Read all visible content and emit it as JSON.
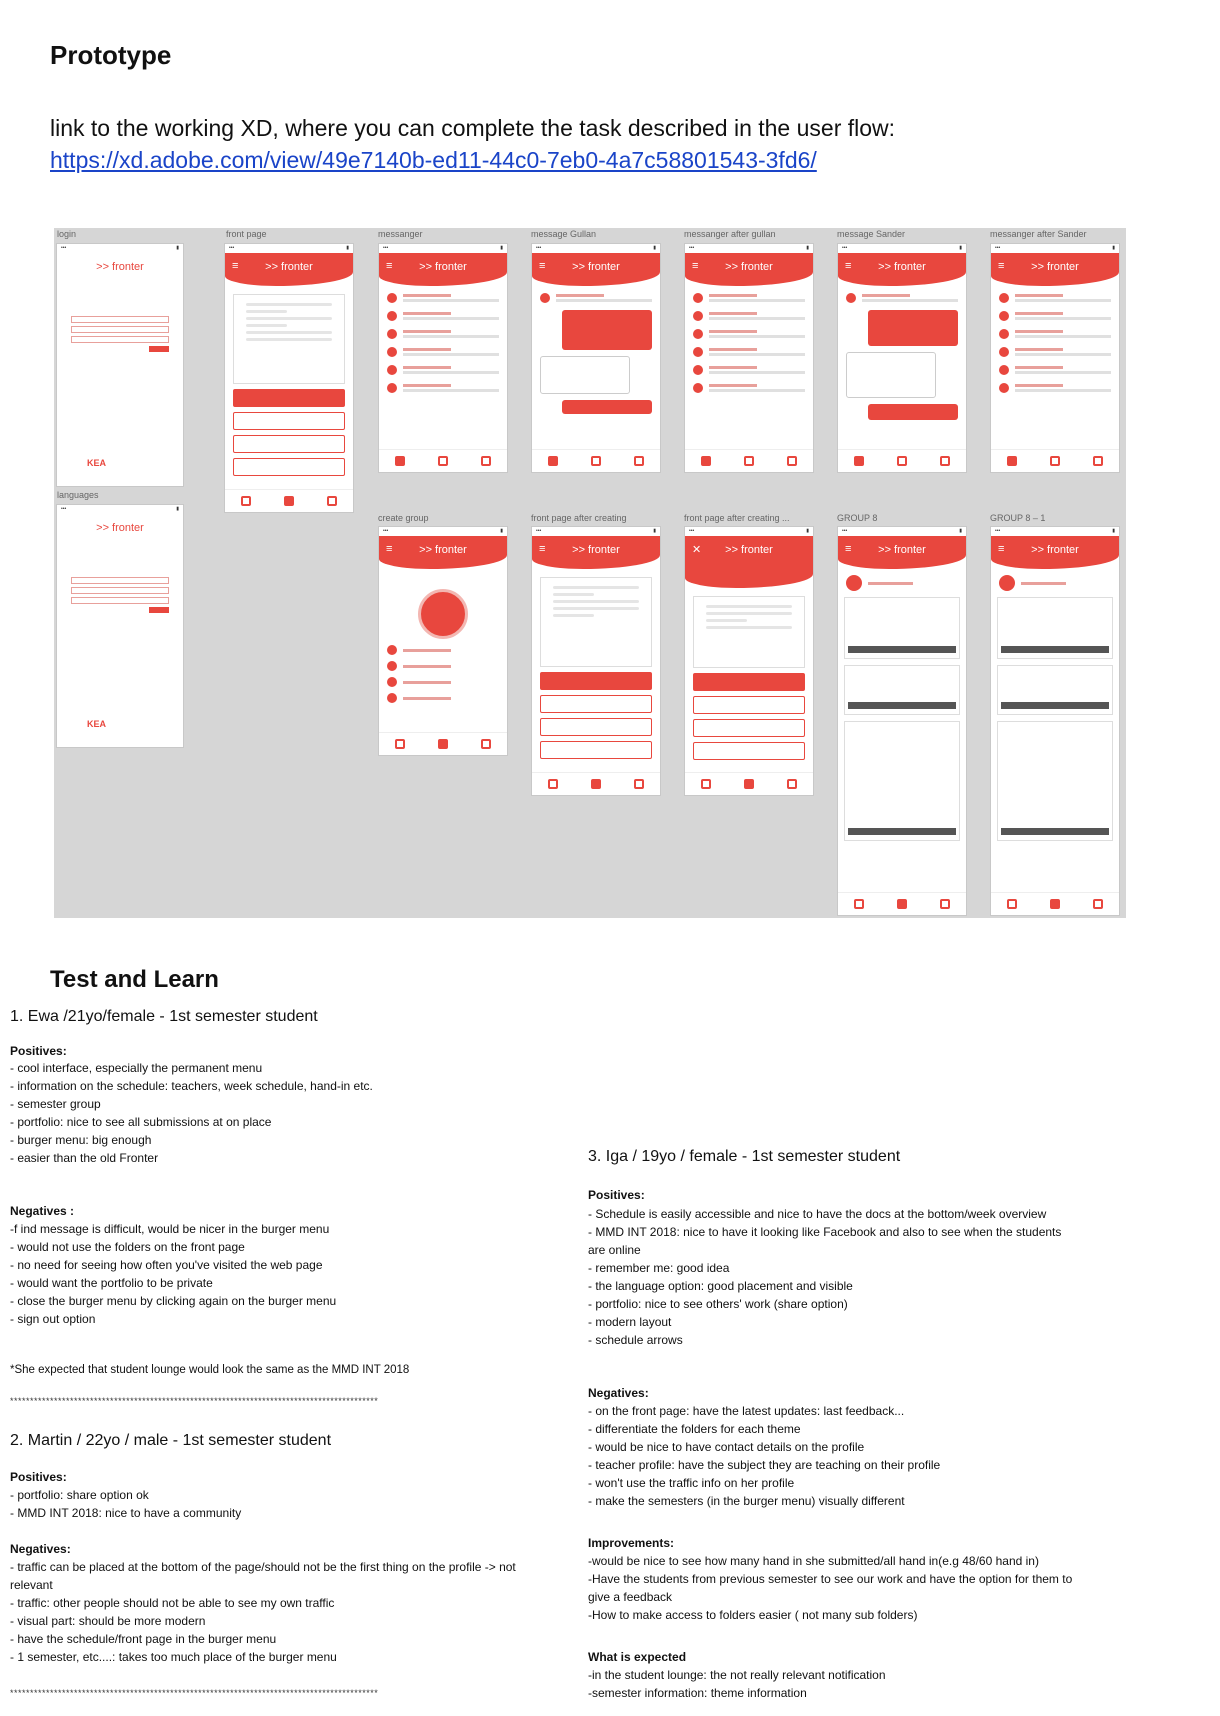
{
  "prototype": {
    "title": "Prototype",
    "intro": "link to the working XD, where you can complete the task described in the user flow:",
    "link": "https://xd.adobe.com/view/49e7140b-ed11-44c0-7eb0-4a7c58801543-3fd6/"
  },
  "artboards": {
    "accent": "#e8473e",
    "brand": ">> fronter",
    "labels": [
      "login",
      "front page",
      "messanger",
      "message Gullan",
      "messanger after gullan",
      "message Sander",
      "messanger after Sander",
      "languages",
      "create group",
      "front page after creating",
      "front page after creating ...",
      "GROUP 8",
      "GROUP 8 – 1"
    ]
  },
  "test": {
    "title": "Test and Learn",
    "p1": {
      "heading": "1. Ewa /21yo/female - 1st semester student",
      "positives_title": "Positives:",
      "positives": [
        "- cool interface, especially the permanent menu",
        "- information on the schedule: teachers, week schedule, hand-in etc.",
        "- semester group",
        "- portfolio: nice to see all submissions at on place",
        "- burger menu: big enough",
        "- easier than the old Fronter"
      ],
      "negatives_title": "Negatives :",
      "negatives": [
        "-f ind message is difficult, would be nicer in the burger menu",
        "- would not use the folders on the front page",
        "- no need for seeing how often you've visited the web page",
        "- would want the portfolio to be private",
        "- close the burger menu by clicking again on the burger menu",
        "- sign out option"
      ],
      "note": "*She expected that student lounge would look the same as the MMD INT 2018"
    },
    "separator": "********************************************************************************************",
    "p2": {
      "heading": "2. Martin / 22yo / male - 1st semester student",
      "positives_title": "Positives:",
      "positives": [
        "- portfolio: share option ok",
        "- MMD INT 2018: nice to have a community"
      ],
      "negatives_title": "Negatives:",
      "negatives": [
        "- traffic can be placed at the bottom of the page/should not be the first thing on the profile -> not",
        "relevant",
        "- traffic: other people should not be able to see my own traffic",
        "- visual part: should be more modern",
        "- have the schedule/front page in the burger menu",
        "- 1 semester, etc....: takes too much place of the burger menu"
      ]
    },
    "p3": {
      "heading": "3. Iga / 19yo / female - 1st semester student",
      "positives_title": "Positives:",
      "positives": [
        "- Schedule is easily accessible and nice to have the docs at the bottom/week overview",
        "- MMD INT 2018: nice to have it looking like Facebook and also to see when the students",
        "are online",
        "- remember me: good idea",
        "- the language option: good placement and visible",
        "- portfolio: nice to see others' work (share option)",
        "- modern layout",
        "- schedule arrows"
      ],
      "negatives_title": "Negatives:",
      "negatives": [
        "- on the front page: have the latest updates: last feedback...",
        "- differentiate the folders for each theme",
        "- would be nice to have contact details on the profile",
        "- teacher profile: have the subject they are teaching on their profile",
        "- won't use the traffic info on her profile",
        "- make the semesters (in the burger menu) visually different"
      ],
      "improvements_title": "Improvements:",
      "improvements": [
        "-would be nice to see how many hand in she submitted/all hand in(e.g 48/60 hand in)",
        "-Have the students from previous semester to see our work and have the option for them to",
        "give a feedback",
        "-How to make access to folders easier ( not many sub folders)"
      ],
      "expected_title": "What is expected",
      "expected": [
        "-in the student lounge: the not really relevant notification",
        "-semester information: theme information"
      ]
    }
  }
}
